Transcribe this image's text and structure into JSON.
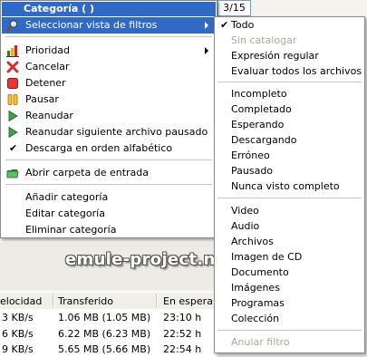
{
  "badge": "3/15",
  "watermark": "emule-project.net",
  "menu": {
    "title": "Categoría ( )",
    "items": [
      {
        "label": "Seleccionar vista de filtros"
      },
      {
        "label": "Prioridad"
      },
      {
        "label": "Cancelar"
      },
      {
        "label": "Detener"
      },
      {
        "label": "Pausar"
      },
      {
        "label": "Reanudar"
      },
      {
        "label": "Reanudar siguiente archivo pausado"
      },
      {
        "label": "Descarga en orden alfabético"
      },
      {
        "label": "Abrir carpeta de entrada"
      },
      {
        "label": "Añadir categoría"
      },
      {
        "label": "Editar categoría"
      },
      {
        "label": "Eliminar categoría"
      }
    ]
  },
  "submenu": {
    "items": [
      {
        "label": "Todo"
      },
      {
        "label": "Sin catalogar"
      },
      {
        "label": "Expresión regular"
      },
      {
        "label": "Evaluar todos los archivos"
      },
      {
        "label": "Incompleto"
      },
      {
        "label": "Completado"
      },
      {
        "label": "Esperando"
      },
      {
        "label": "Descargando"
      },
      {
        "label": "Erróneo"
      },
      {
        "label": "Pausado"
      },
      {
        "label": "Nunca visto completo"
      },
      {
        "label": "Video"
      },
      {
        "label": "Audio"
      },
      {
        "label": "Archivos"
      },
      {
        "label": "Imagen de CD"
      },
      {
        "label": "Documento"
      },
      {
        "label": "Imágenes"
      },
      {
        "label": "Programas"
      },
      {
        "label": "Colección"
      },
      {
        "label": "Anular filtro"
      }
    ]
  },
  "table": {
    "headers": [
      "elocidad",
      "Transferido",
      "En espera"
    ],
    "rows": [
      [
        "3 KB/s",
        "1.06 MB (1.05 MB)",
        "23:10 h"
      ],
      [
        "6 KB/s",
        "6.22 MB (6.23 MB)",
        "22:52 h"
      ],
      [
        "9 KB/s",
        "5.65 MB (5.66 MB)",
        "22:54 h"
      ]
    ]
  },
  "colors": {
    "highlight": "#316ac5",
    "disabled": "#aca899"
  }
}
